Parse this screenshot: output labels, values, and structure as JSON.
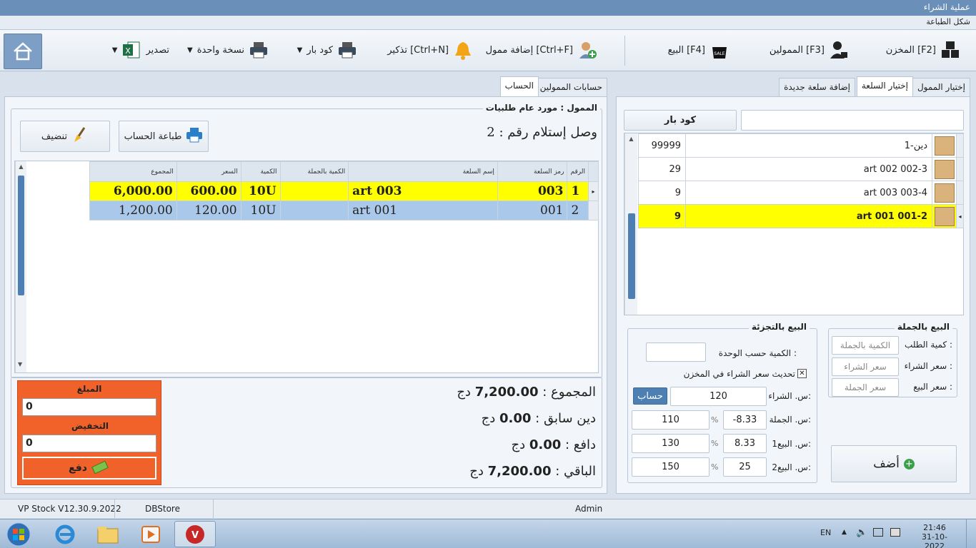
{
  "window": {
    "title": "عملية الشراء",
    "menu": "شكل الطباعة"
  },
  "toolbar": {
    "warehouse": "المخزن [F2]",
    "suppliers": "الممولين [F3]",
    "sale": "البيع [F4]",
    "add_supplier": "إضافة ممول [Ctrl+F]",
    "reminder": "تذكير [Ctrl+N]",
    "barcode": "كود بار",
    "single_copy": "نسخة واحدة",
    "export": "تصدير"
  },
  "right_panel": {
    "tabs": [
      "إختيار الممول",
      "إختيار السلعة",
      "إضافة سلعة جديدة"
    ],
    "barcode_button": "كود بار",
    "search_value": "",
    "items": [
      {
        "name": "1-دين",
        "qty": "99999"
      },
      {
        "name": "art 002 002-3",
        "qty": "29"
      },
      {
        "name": "art 003 003-4",
        "qty": "9"
      },
      {
        "name": "art 001 001-2",
        "qty": "9"
      }
    ],
    "wholesale": {
      "title": "البيع بالجملة",
      "order_qty_label": "كمية الطلب :",
      "order_qty_placeholder": "الكمية بالجملة",
      "buy_price_label": "سعر الشراء :",
      "buy_price_placeholder": "سعر الشراء",
      "sell_price_label": "سعر البيع :",
      "sell_price_placeholder": "سعر الجملة"
    },
    "retail": {
      "title": "البيع بالتجزئة",
      "unit_qty_label": "الكمية حسب الوحدة :",
      "update_price_label": "تحديث سعر الشراء في المخزن",
      "buy_label": "س. الشراء:",
      "buy_value": "120",
      "calc_button": "حساب",
      "wholesale_label": "س. الجملة:",
      "wholesale_pct": "-8.33",
      "wholesale_value": "110",
      "sell1_label": "س. البيع1:",
      "sell1_pct": "8.33",
      "sell1_value": "130",
      "sell2_label": "س. البيع2:",
      "sell2_pct": "25",
      "sell2_value": "150",
      "pct_symbol": "%"
    },
    "add_button": "أضف"
  },
  "left_panel": {
    "tabs": [
      "حسابات الممولين",
      "الحساب"
    ],
    "supplier_label": "الممول : مورد عام طلبيات",
    "receipt": "وصل إستلام رقم : 2",
    "print_button": "طباعة الحساب",
    "clean_button": "تنضيف",
    "columns": [
      "الرقم",
      "رمز السلعة",
      "إسم السلعة",
      "الكمية بالجملة",
      "الكمية",
      "السعر",
      "المجموع"
    ],
    "rows": [
      {
        "num": "1",
        "code": "003",
        "name": "art 003",
        "wqty": "",
        "qty": "10U",
        "price": "600.00",
        "total": "6,000.00"
      },
      {
        "num": "2",
        "code": "001",
        "name": "art 001",
        "wqty": "",
        "qty": "10U",
        "price": "120.00",
        "total": "1,200.00"
      }
    ],
    "totals": {
      "sum_label": "المجموع :",
      "sum_value": "7,200.00",
      "currency": "دج",
      "prev_debt_label": "دين سابق :",
      "prev_debt_value": "0.00",
      "paid_label": "دافع :",
      "paid_value": "0.00",
      "remaining_label": "الباقي :",
      "remaining_value": "7,200.00"
    },
    "payment": {
      "amount_label": "المبلغ",
      "amount_value": "0",
      "discount_label": "التخفيض",
      "discount_value": "0",
      "pay_button": "دفع"
    }
  },
  "status": {
    "version": "VP Stock V12.30.9.2022",
    "db": "DBStore",
    "user": "Admin"
  },
  "taskbar": {
    "lang": "EN",
    "time": "21:46",
    "date": "31-10-2022"
  },
  "colors": {
    "titlebar": "#6a8fb8",
    "selected_row": "#ffff00",
    "second_row": "#a9c8ea",
    "payment_box": "#f0622a",
    "scroll_thumb": "#4d7fb3"
  }
}
